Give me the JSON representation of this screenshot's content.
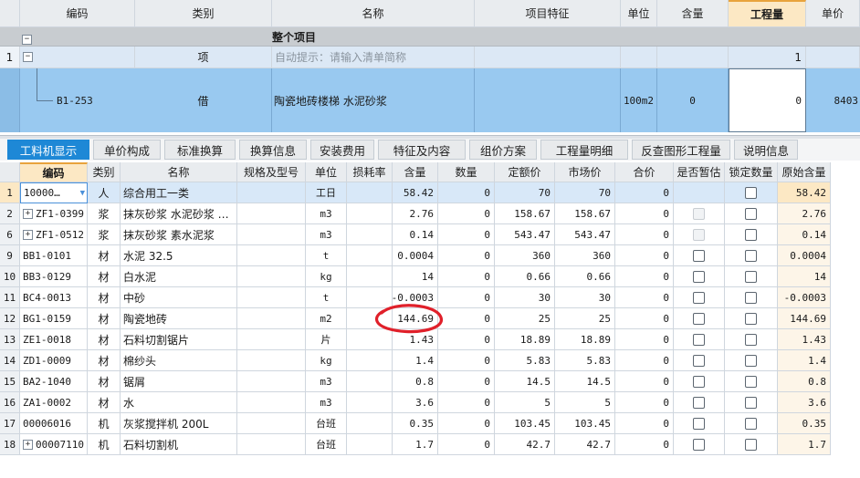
{
  "top_table": {
    "headers": [
      "编码",
      "类别",
      "名称",
      "项目特征",
      "单位",
      "含量",
      "工程量",
      "单价"
    ],
    "section_row": {
      "label": "整个项目"
    },
    "row1": {
      "num": "1",
      "type": "项",
      "hint": "自动提示：请输入清单简称",
      "qty": "1"
    },
    "row2": {
      "code": "B1-253",
      "type": "借",
      "name": "陶瓷地砖楼梯 水泥砂浆",
      "unit": "100m2",
      "content": "0",
      "qty": "0",
      "price": "8403"
    }
  },
  "tabs": [
    "工料机显示",
    "单价构成",
    "标准换算",
    "换算信息",
    "安装费用",
    "特征及内容",
    "组价方案",
    "工程量明细",
    "反查图形工程量",
    "说明信息"
  ],
  "bottom_table": {
    "headers": [
      "编码",
      "类别",
      "名称",
      "规格及型号",
      "单位",
      "损耗率",
      "含量",
      "数量",
      "定额价",
      "市场价",
      "合价",
      "是否暂估",
      "锁定数量",
      "原始含量"
    ],
    "rows": [
      {
        "num": "1",
        "code": "10000…",
        "type": "人",
        "name": "综合用工一类",
        "unit": "工日",
        "content": "58.42",
        "amount": "0",
        "quota": "70",
        "market": "70",
        "total": "0",
        "orig": "58.42"
      },
      {
        "num": "2",
        "code": "ZF1-0399",
        "type": "浆",
        "name": "抹灰砂浆 水泥砂浆 …",
        "unit": "m3",
        "content": "2.76",
        "amount": "0",
        "quota": "158.67",
        "market": "158.67",
        "total": "0",
        "orig": "2.76"
      },
      {
        "num": "6",
        "code": "ZF1-0512",
        "type": "浆",
        "name": "抹灰砂浆 素水泥浆",
        "unit": "m3",
        "content": "0.14",
        "amount": "0",
        "quota": "543.47",
        "market": "543.47",
        "total": "0",
        "orig": "0.14"
      },
      {
        "num": "9",
        "code": "BB1-0101",
        "type": "材",
        "name": "水泥 32.5",
        "unit": "t",
        "content": "0.0004",
        "amount": "0",
        "quota": "360",
        "market": "360",
        "total": "0",
        "orig": "0.0004"
      },
      {
        "num": "10",
        "code": "BB3-0129",
        "type": "材",
        "name": "白水泥",
        "unit": "kg",
        "content": "14",
        "amount": "0",
        "quota": "0.66",
        "market": "0.66",
        "total": "0",
        "orig": "14"
      },
      {
        "num": "11",
        "code": "BC4-0013",
        "type": "材",
        "name": "中砂",
        "unit": "t",
        "content": "-0.0003",
        "amount": "0",
        "quota": "30",
        "market": "30",
        "total": "0",
        "orig": "-0.0003"
      },
      {
        "num": "12",
        "code": "BG1-0159",
        "type": "材",
        "name": "陶瓷地砖",
        "unit": "m2",
        "content": "144.69",
        "amount": "0",
        "quota": "25",
        "market": "25",
        "total": "0",
        "orig": "144.69"
      },
      {
        "num": "13",
        "code": "ZE1-0018",
        "type": "材",
        "name": "石料切割锯片",
        "unit": "片",
        "content": "1.43",
        "amount": "0",
        "quota": "18.89",
        "market": "18.89",
        "total": "0",
        "orig": "1.43"
      },
      {
        "num": "14",
        "code": "ZD1-0009",
        "type": "材",
        "name": "棉纱头",
        "unit": "kg",
        "content": "1.4",
        "amount": "0",
        "quota": "5.83",
        "market": "5.83",
        "total": "0",
        "orig": "1.4"
      },
      {
        "num": "15",
        "code": "BA2-1040",
        "type": "材",
        "name": "锯屑",
        "unit": "m3",
        "content": "0.8",
        "amount": "0",
        "quota": "14.5",
        "market": "14.5",
        "total": "0",
        "orig": "0.8"
      },
      {
        "num": "16",
        "code": "ZA1-0002",
        "type": "材",
        "name": "水",
        "unit": "m3",
        "content": "3.6",
        "amount": "0",
        "quota": "5",
        "market": "5",
        "total": "0",
        "orig": "3.6"
      },
      {
        "num": "17",
        "code": "00006016",
        "type": "机",
        "name": "灰浆搅拌机 200L",
        "unit": "台班",
        "content": "0.35",
        "amount": "0",
        "quota": "103.45",
        "market": "103.45",
        "total": "0",
        "orig": "0.35"
      },
      {
        "num": "18",
        "code": "00007110",
        "type": "机",
        "name": "石料切割机",
        "unit": "台班",
        "content": "1.7",
        "amount": "0",
        "quota": "42.7",
        "market": "42.7",
        "total": "0",
        "orig": "1.7"
      }
    ]
  },
  "colors": {
    "selected_row": "#99c9f0",
    "active_tab": "#1e88d6",
    "highlight_header": "#fce8c4",
    "annotation": "#e0202a"
  }
}
